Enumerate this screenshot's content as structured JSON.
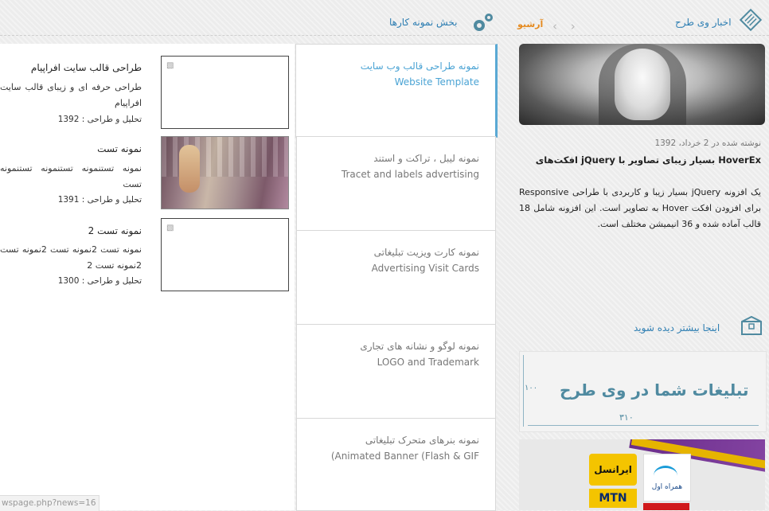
{
  "header": {
    "news_title": "اخبار وی طرح",
    "archive_label": "آرشیو",
    "nav_arrows": "‹ ›",
    "works_title": "بخش نمونه کارها"
  },
  "news": {
    "posted": "نوشته شده در 2 خرداد، 1392",
    "headline": "افکت‌های jQuery بسیار زیبای تصاویر با HoverEx",
    "body": "یک افزونه jQuery بسیار زیبا و کاربردی با طراحی Responsive برای افزودن افکت Hover به تصاویر است. این افزونه شامل 18 قالب آماده شده و 36 انیمیشن مختلف است.",
    "more_link": "اینجا بیشتر دیده شوید"
  },
  "ads": {
    "banner_text": "تبلیغات شما در وی طرح",
    "dim_width": "۳۱۰",
    "dim_height": "۱۰۰",
    "irancell": "ایرانسل",
    "mtn": "MTN",
    "hamrah": "همراه اول"
  },
  "tabs": [
    {
      "fa": "نمونه طراحی قالب وب سایت",
      "en": "Website Template"
    },
    {
      "fa": "نمونه لیبل ، تراکت و استند",
      "en": "Tracet and labels advertising"
    },
    {
      "fa": "نمونه کارت ویزیت تبلیغاتی",
      "en": "Advertising Visit Cards"
    },
    {
      "fa": "نمونه لوگو و نشانه های تجاری",
      "en": "LOGO and Trademark"
    },
    {
      "fa": "نمونه بنرهای متحرک تبلیغاتی",
      "en": "(Animated Banner (Flash & GIF"
    }
  ],
  "items": [
    {
      "title": "طراحی قالب سایت افراپیام",
      "desc": "طراحی حرفه ای و زیبای قالب سایت افراپیام",
      "date": "تحلیل و طراحی : 1392"
    },
    {
      "title": "نمونه تست",
      "desc": "نمونه تستنمونه تستنمونه تستنمونه تست",
      "date": "تحلیل و طراحی : 1391"
    },
    {
      "title": "نمونه تست 2",
      "desc": "نمونه تست 2نمونه تست 2نمونه تست 2نمونه تست 2",
      "date": "تحلیل و طراحی : 1300"
    }
  ],
  "status_url": "wspage.php?news=16",
  "colors": {
    "accent": "#2f7fb3",
    "archive": "#e58a1f",
    "active_tab": "#4aa3d4"
  }
}
